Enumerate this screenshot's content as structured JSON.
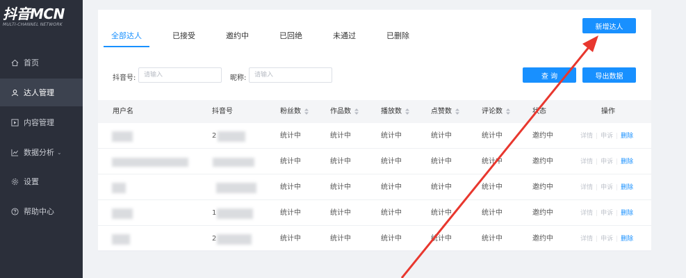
{
  "sidebar": {
    "logo_main": "抖音MCN",
    "logo_sub": "MULTI-CHANNEL NETWORK",
    "items": [
      {
        "label": "首页",
        "icon": "home-icon"
      },
      {
        "label": "达人管理",
        "icon": "user-icon"
      },
      {
        "label": "内容管理",
        "icon": "play-square-icon"
      },
      {
        "label": "数据分析",
        "icon": "line-chart-icon"
      },
      {
        "label": "设置",
        "icon": "gear-icon"
      },
      {
        "label": "帮助中心",
        "icon": "question-circle-icon"
      }
    ]
  },
  "tabs": [
    "全部达人",
    "已接受",
    "邀约中",
    "已回绝",
    "未通过",
    "已删除"
  ],
  "buttons": {
    "new": "新增达人",
    "query": "查 询",
    "export": "导出数据"
  },
  "filters": {
    "douyin_label": "抖音号:",
    "douyin_placeholder": "请输入",
    "nickname_label": "昵称:",
    "nickname_placeholder": "请输入"
  },
  "table": {
    "columns": [
      "用户名",
      "抖音号",
      "粉丝数",
      "作品数",
      "播放数",
      "点赞数",
      "评论数",
      "状态",
      "操作"
    ],
    "rows": [
      {
        "fans": "统计中",
        "works": "统计中",
        "plays": "统计中",
        "likes": "统计中",
        "comments": "统计中",
        "status": "邀约中",
        "douyin_prefix": "2"
      },
      {
        "fans": "统计中",
        "works": "统计中",
        "plays": "统计中",
        "likes": "统计中",
        "comments": "统计中",
        "status": "邀约中",
        "douyin_prefix": ""
      },
      {
        "fans": "统计中",
        "works": "统计中",
        "plays": "统计中",
        "likes": "统计中",
        "comments": "统计中",
        "status": "邀约中",
        "douyin_prefix": ""
      },
      {
        "fans": "统计中",
        "works": "统计中",
        "plays": "统计中",
        "likes": "统计中",
        "comments": "统计中",
        "status": "邀约中",
        "douyin_prefix": "1"
      },
      {
        "fans": "统计中",
        "works": "统计中",
        "plays": "统计中",
        "likes": "统计中",
        "comments": "统计中",
        "status": "邀约中",
        "douyin_prefix": "2"
      }
    ],
    "ops": {
      "detail": "详情",
      "appeal": "申诉",
      "delete": "删除"
    }
  },
  "colors": {
    "primary": "#1890ff",
    "sidebar_bg": "#2b2f3a",
    "arrow": "#e8372e"
  }
}
